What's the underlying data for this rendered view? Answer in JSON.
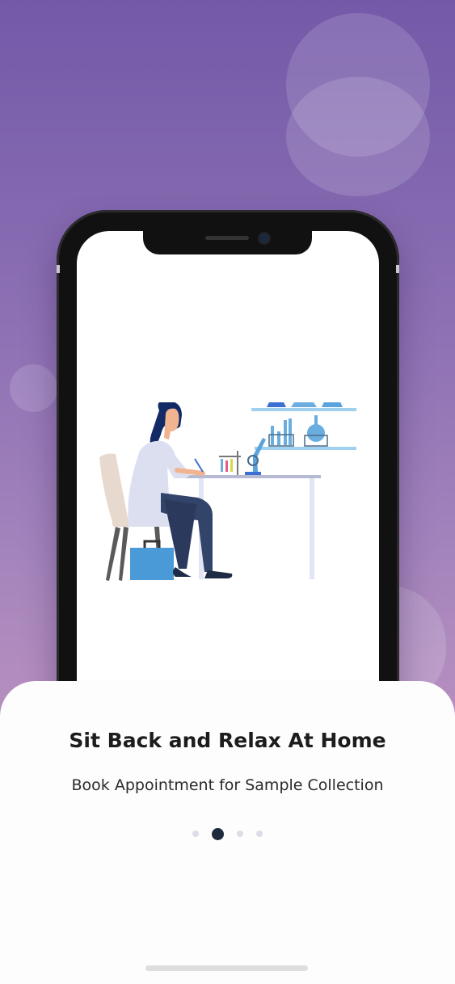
{
  "onboarding": {
    "title": "Sit Back and Relax At Home",
    "subtitle": "Book Appointment for Sample Collection",
    "pagination": {
      "total": 4,
      "active_index": 1
    }
  },
  "illustration": {
    "icon": "lab-technician-illustration"
  },
  "colors": {
    "background_top": "#7359a8",
    "background_bottom": "#c89bc3",
    "sheet": "#fdfdfd",
    "title_text": "#1c1c1c",
    "active_dot": "#1e2b3d",
    "inactive_dot": "#dcdde6",
    "lab_blue": "#4a9ad8"
  }
}
